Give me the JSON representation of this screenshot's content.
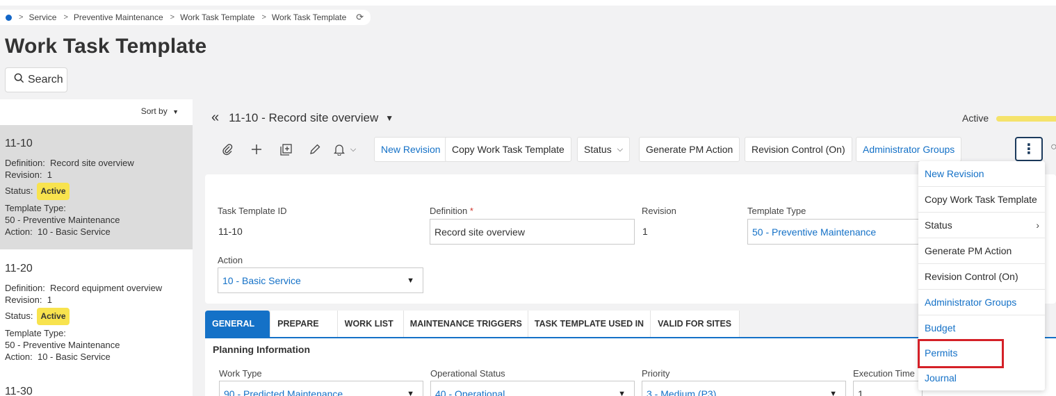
{
  "breadcrumb": {
    "items": [
      "Service",
      "Preventive Maintenance",
      "Work Task Template",
      "Work Task Template"
    ]
  },
  "page": {
    "title": "Work Task Template",
    "search_label": "Search"
  },
  "list": {
    "sort_label": "Sort by",
    "records": [
      {
        "id": "11-10",
        "definition_label": "Definition:",
        "definition": "Record site overview",
        "revision_label": "Revision:",
        "revision": "1",
        "status_label": "Status:",
        "status": "Active",
        "template_type_label": "Template Type:",
        "template_type": "50 - Preventive Maintenance",
        "action_label": "Action:",
        "action": "10 - Basic Service"
      },
      {
        "id": "11-20",
        "definition_label": "Definition:",
        "definition": "Record equipment overview",
        "revision_label": "Revision:",
        "revision": "1",
        "status_label": "Status:",
        "status": "Active",
        "template_type_label": "Template Type:",
        "template_type": "50 - Preventive Maintenance",
        "action_label": "Action:",
        "action": "10 - Basic Service"
      },
      {
        "id": "11-30"
      }
    ]
  },
  "detail": {
    "title": "11-10 - Record site overview",
    "state": "Active",
    "toolbar": {
      "new_revision": "New Revision",
      "copy": "Copy Work Task Template",
      "status": "Status",
      "generate_pm": "Generate PM Action",
      "revision_control": "Revision Control (On)",
      "admin_groups": "Administrator Groups"
    },
    "form": {
      "task_template_id_label": "Task Template ID",
      "task_template_id": "11-10",
      "definition_label": "Definition",
      "required_mark": "*",
      "definition": "Record site overview",
      "revision_label": "Revision",
      "revision": "1",
      "template_type_label": "Template Type",
      "template_type": "50 - Preventive Maintenance",
      "action_label": "Action",
      "action": "10 - Basic Service"
    },
    "tabs": [
      "GENERAL",
      "PREPARE",
      "WORK LIST",
      "MAINTENANCE TRIGGERS",
      "TASK TEMPLATE USED IN",
      "VALID FOR SITES"
    ],
    "general": {
      "section_title": "Planning Information",
      "work_type_label": "Work Type",
      "work_type": "90 - Predicted Maintenance",
      "op_status_label": "Operational Status",
      "op_status": "40 - Operational",
      "priority_label": "Priority",
      "priority": "3 - Medium (P3)",
      "exec_time_label": "Execution Time",
      "exec_time": "1"
    }
  },
  "menu": {
    "items": [
      "New Revision",
      "Copy Work Task Template",
      "Status",
      "Generate PM Action",
      "Revision Control (On)",
      "Administrator Groups",
      "Budget",
      "Permits",
      "Journal"
    ]
  },
  "colors": {
    "link": "#1471c7",
    "badge": "#f8e34e",
    "highlight": "#d42027"
  }
}
